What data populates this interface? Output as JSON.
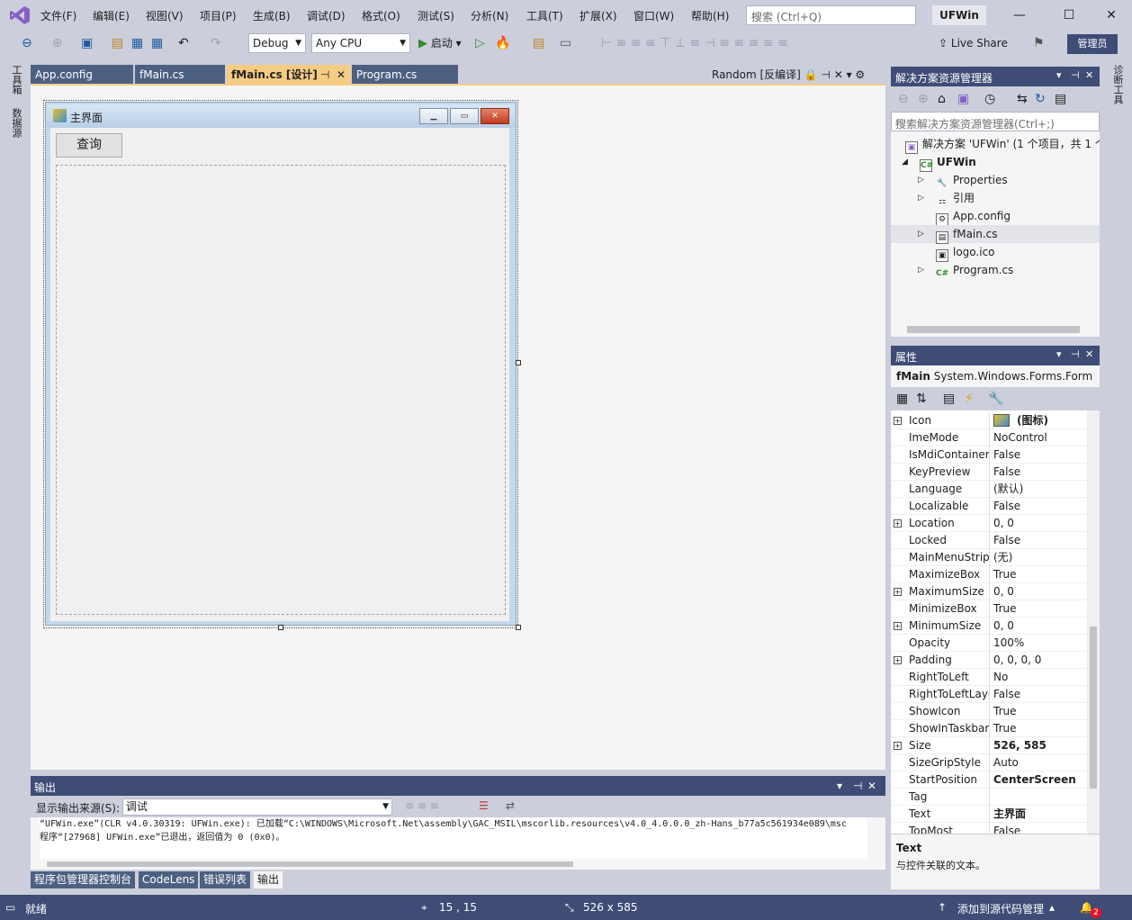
{
  "menu": {
    "items": [
      "文件(F)",
      "编辑(E)",
      "视图(V)",
      "项目(P)",
      "生成(B)",
      "调试(D)",
      "格式(O)",
      "测试(S)",
      "分析(N)",
      "工具(T)",
      "扩展(X)",
      "窗口(W)",
      "帮助(H)"
    ],
    "search_placeholder": "搜索 (Ctrl+Q)",
    "solution_name": "UFWin"
  },
  "toolbar": {
    "config": "Debug",
    "platform": "Any CPU",
    "start_label": "启动",
    "liveshare_label": "Live Share",
    "admin_label": "管理员"
  },
  "left_strip": {
    "toolbox": "工具箱",
    "datasource": "数据源"
  },
  "right_strip": {
    "diagnostics": "诊断工具"
  },
  "doc_tabs": {
    "tabs": [
      "App.config",
      "fMain.cs",
      "fMain.cs [设计]",
      "Program.cs"
    ],
    "random_tab": "Random [反编译]"
  },
  "designer": {
    "form_title": "主界面",
    "query_button": "查询"
  },
  "output": {
    "title": "输出",
    "source_label": "显示输出来源(S):",
    "source_value": "调试",
    "lines": [
      "“UFWin.exe”(CLR v4.0.30319: UFWin.exe): 已加载“C:\\WINDOWS\\Microsoft.Net\\assembly\\GAC_MSIL\\mscorlib.resources\\v4.0_4.0.0.0_zh-Hans_b77a5c561934e089\\msc",
      "程序“[27968] UFWin.exe”已退出，返回值为 0 (0x0)。"
    ]
  },
  "bottom_tabs": [
    "程序包管理器控制台",
    "CodeLens",
    "错误列表",
    "输出"
  ],
  "status": {
    "ready": "就绪",
    "position": "15 , 15",
    "size": "526 x 585",
    "source_control": "添加到源代码管理",
    "notifications": "2"
  },
  "solution_explorer": {
    "title": "解决方案资源管理器",
    "search_placeholder": "搜索解决方案资源管理器(Ctrl+;)",
    "solution_line": "解决方案 'UFWin' (1 个项目，共 1 个",
    "project": "UFWin",
    "items": [
      "Properties",
      "引用",
      "App.config",
      "fMain.cs",
      "logo.ico",
      "Program.cs"
    ]
  },
  "properties": {
    "title": "属性",
    "object_name": "fMain",
    "object_type": "System.Windows.Forms.Form",
    "rows": [
      {
        "name": "Icon",
        "value": "(图标)",
        "exp": true,
        "bold": true
      },
      {
        "name": "ImeMode",
        "value": "NoControl"
      },
      {
        "name": "IsMdiContainer",
        "value": "False"
      },
      {
        "name": "KeyPreview",
        "value": "False"
      },
      {
        "name": "Language",
        "value": "(默认)"
      },
      {
        "name": "Localizable",
        "value": "False"
      },
      {
        "name": "Location",
        "value": "0, 0",
        "exp": true
      },
      {
        "name": "Locked",
        "value": "False"
      },
      {
        "name": "MainMenuStrip",
        "value": "(无)"
      },
      {
        "name": "MaximizeBox",
        "value": "True"
      },
      {
        "name": "MaximumSize",
        "value": "0, 0",
        "exp": true
      },
      {
        "name": "MinimizeBox",
        "value": "True"
      },
      {
        "name": "MinimumSize",
        "value": "0, 0",
        "exp": true
      },
      {
        "name": "Opacity",
        "value": "100%"
      },
      {
        "name": "Padding",
        "value": "0, 0, 0, 0",
        "exp": true
      },
      {
        "name": "RightToLeft",
        "value": "No"
      },
      {
        "name": "RightToLeftLayout",
        "value": "False"
      },
      {
        "name": "ShowIcon",
        "value": "True"
      },
      {
        "name": "ShowInTaskbar",
        "value": "True"
      },
      {
        "name": "Size",
        "value": "526, 585",
        "exp": true,
        "bold": true
      },
      {
        "name": "SizeGripStyle",
        "value": "Auto"
      },
      {
        "name": "StartPosition",
        "value": "CenterScreen",
        "bold": true
      },
      {
        "name": "Tag",
        "value": ""
      },
      {
        "name": "Text",
        "value": "主界面",
        "bold": true
      },
      {
        "name": "TopMost",
        "value": "False"
      }
    ],
    "desc_name": "Text",
    "desc_text": "与控件关联的文本。"
  }
}
